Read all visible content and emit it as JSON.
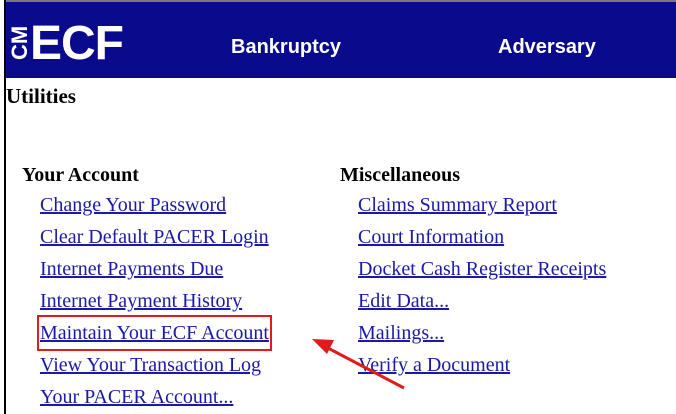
{
  "header": {
    "logo_prefix": "CM",
    "logo_text": "ECF",
    "menu": [
      "Bankruptcy",
      "Adversary"
    ]
  },
  "page": {
    "title": "Utilities"
  },
  "your_account": {
    "heading": "Your Account",
    "links": [
      "Change Your Password",
      "Clear Default PACER Login",
      "Internet Payments Due",
      "Internet Payment History",
      "Maintain Your ECF Account",
      "View Your Transaction Log",
      "Your PACER Account..."
    ]
  },
  "miscellaneous": {
    "heading": "Miscellaneous",
    "links": [
      "Claims Summary Report",
      "Court Information",
      "Docket Cash Register Receipts",
      "Edit Data...",
      "Mailings...",
      "Verify a Document"
    ]
  },
  "annotation": {
    "highlight_color": "#e11b1b"
  },
  "colors": {
    "navbar": "#0a0a8c",
    "link": "#1a1aa6"
  }
}
